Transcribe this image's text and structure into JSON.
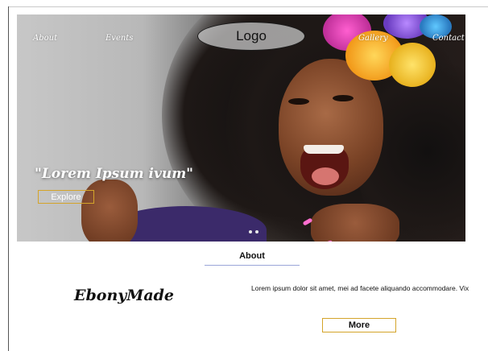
{
  "nav": {
    "items": [
      {
        "label": "About"
      },
      {
        "label": "Events"
      },
      {
        "label": "Gallery"
      },
      {
        "label": "Contact"
      }
    ],
    "logo": "Logo"
  },
  "hero": {
    "tagline": "\"Lorem Ipsum ivum\"",
    "explore_label": "Explore",
    "carousel": {
      "slide_count": 2,
      "active_index": 0
    }
  },
  "about": {
    "heading": "About",
    "brand": "EbonyMade",
    "text": "Lorem ipsum dolor sit amet, mei ad facete aliquando accommodare. Vix",
    "more_label": "More"
  },
  "colors": {
    "button_border": "#d4a42a",
    "underline": "#9aa6d8"
  }
}
